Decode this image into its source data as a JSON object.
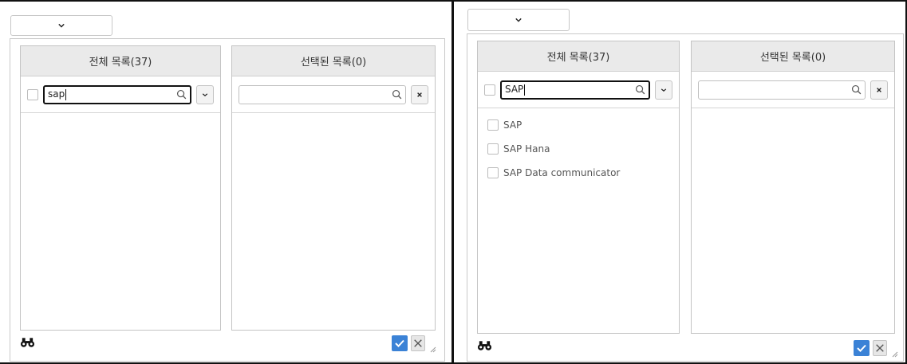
{
  "left": {
    "all_list_title": "전체 목록(37)",
    "selected_list_title": "선택된 목록(0)",
    "search_value": "sap",
    "items": []
  },
  "right": {
    "all_list_title": "전체 목록(37)",
    "selected_list_title": "선택된 목록(0)",
    "search_value": "SAP",
    "items": [
      {
        "label": "SAP"
      },
      {
        "label": "SAP Hana"
      },
      {
        "label": "SAP Data communicator"
      }
    ]
  },
  "icons": {
    "search": "magnifier-icon",
    "dropdown": "chevron-down-icon",
    "clear": "close-icon",
    "finder": "binoculars-icon",
    "confirm": "check-icon",
    "cancel": "x-icon",
    "resize": "resize-grip-icon"
  },
  "colors": {
    "header_bg": "#eaeaea",
    "confirm_blue": "#3b82d6",
    "border": "#c4c4c4"
  }
}
